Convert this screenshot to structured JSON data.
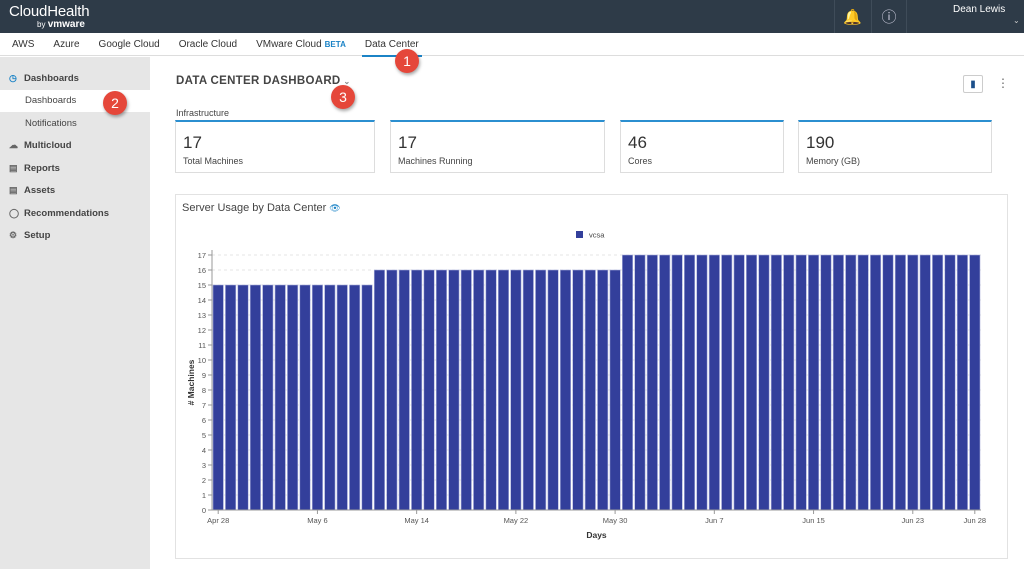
{
  "header": {
    "brand": "CloudHealth",
    "brand_sub_by": "by",
    "brand_sub": "vmware",
    "user": "Dean Lewis",
    "icons": [
      "bell-icon",
      "help-icon"
    ]
  },
  "tabs": [
    {
      "label": "AWS"
    },
    {
      "label": "Azure"
    },
    {
      "label": "Google Cloud"
    },
    {
      "label": "Oracle Cloud"
    },
    {
      "label": "VMware Cloud",
      "badge": "BETA"
    },
    {
      "label": "Data Center",
      "active": true
    }
  ],
  "sidebar": [
    {
      "label": "Dashboards",
      "icon": "gauge-icon"
    },
    {
      "label": "Dashboards",
      "sub": true,
      "selected": true
    },
    {
      "label": "Notifications",
      "sub": true
    },
    {
      "label": "Multicloud",
      "icon": "cloud-icon"
    },
    {
      "label": "Reports",
      "icon": "chart-icon"
    },
    {
      "label": "Assets",
      "icon": "list-icon"
    },
    {
      "label": "Recommendations",
      "icon": "lightbulb-icon"
    },
    {
      "label": "Setup",
      "icon": "gear-icon"
    }
  ],
  "callouts": [
    "1",
    "2",
    "3"
  ],
  "dashboard": {
    "title": "DATA CENTER DASHBOARD",
    "section": "Infrastructure",
    "cards": [
      {
        "value": "17",
        "label": "Total Machines"
      },
      {
        "value": "17",
        "label": "Machines Running"
      },
      {
        "value": "46",
        "label": "Cores"
      },
      {
        "value": "190",
        "label": "Memory (GB)"
      }
    ]
  },
  "colors": {
    "bar": "#333f9b",
    "accent": "#1b83c6",
    "callout": "#e5473a",
    "header": "#2e3b48"
  },
  "chart_data": {
    "type": "bar",
    "title": "Server Usage by Data Center",
    "xlabel": "Days",
    "ylabel": "# Machines",
    "ylim": [
      0,
      17
    ],
    "grid": true,
    "legend_placement": "top",
    "x_ticks": [
      "Apr 28",
      "May 6",
      "May 14",
      "May 22",
      "May 30",
      "Jun 7",
      "Jun 15",
      "Jun 23",
      "Jun 28"
    ],
    "y_ticks": [
      0,
      1,
      2,
      3,
      4,
      5,
      6,
      7,
      8,
      9,
      10,
      11,
      12,
      13,
      14,
      15,
      16,
      17
    ],
    "date_range": [
      "Apr 28",
      "Jun 28"
    ],
    "series": [
      {
        "name": "vcsa",
        "color": "#333f9b",
        "values": [
          15,
          15,
          15,
          15,
          15,
          15,
          15,
          15,
          15,
          15,
          15,
          15,
          15,
          16,
          16,
          16,
          16,
          16,
          16,
          16,
          16,
          16,
          16,
          16,
          16,
          16,
          16,
          16,
          16,
          16,
          16,
          16,
          16,
          17,
          17,
          17,
          17,
          17,
          17,
          17,
          17,
          17,
          17,
          17,
          17,
          17,
          17,
          17,
          17,
          17,
          17,
          17,
          17,
          17,
          17,
          17,
          17,
          17,
          17,
          17,
          17,
          17
        ]
      }
    ]
  }
}
